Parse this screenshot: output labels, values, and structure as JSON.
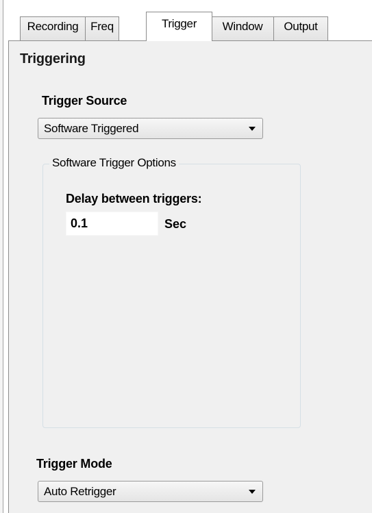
{
  "tabs": [
    {
      "label": "Recording"
    },
    {
      "label": "Freq"
    },
    {
      "label": "Trigger"
    },
    {
      "label": "Window"
    },
    {
      "label": "Output"
    }
  ],
  "active_tab": "Trigger",
  "section_title": "Triggering",
  "trigger_source": {
    "label": "Trigger Source",
    "selected": "Software Triggered"
  },
  "software_trigger_options": {
    "legend": "Software Trigger Options",
    "delay_label": "Delay between triggers:",
    "delay_value": "0.1",
    "delay_unit": "Sec"
  },
  "trigger_mode": {
    "label": "Trigger Mode",
    "selected": "Auto Retrigger"
  },
  "colors": {
    "panel_bg": "#f0f0f0",
    "tab_border": "#8c8c8c",
    "group_border": "#d5dfe5"
  }
}
